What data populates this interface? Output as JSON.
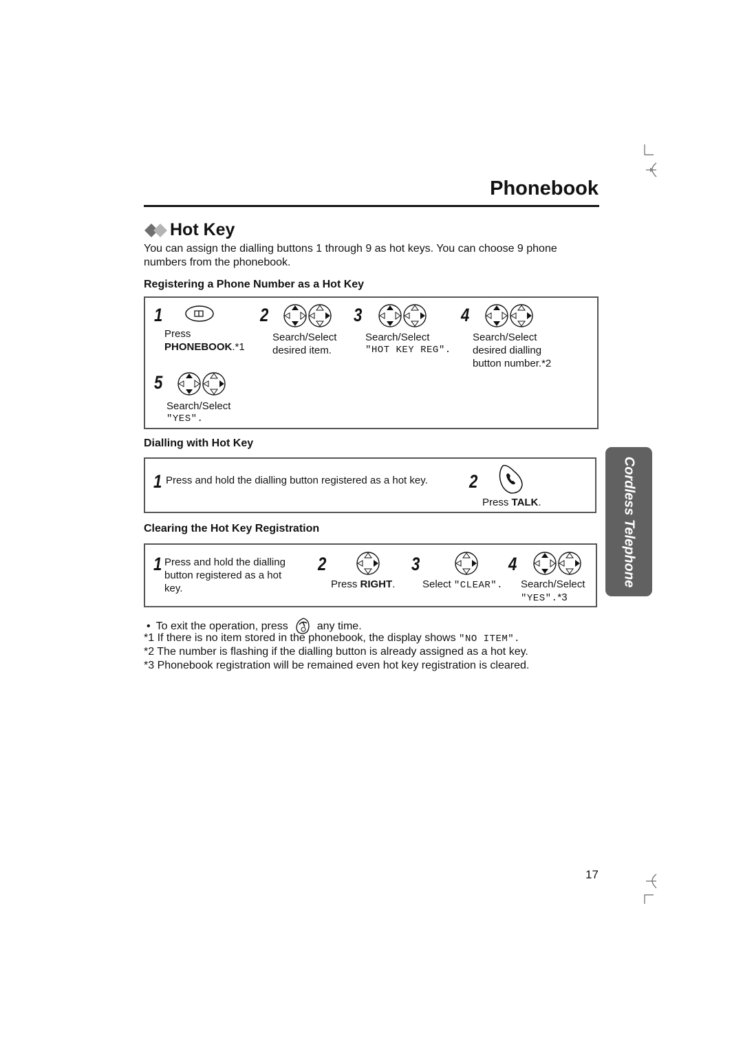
{
  "header": {
    "title": "Phonebook"
  },
  "section": {
    "title": "Hot Key",
    "intro": "You can assign the dialling buttons 1 through 9 as hot keys. You can choose 9 phone",
    "intro2": "numbers from the phonebook."
  },
  "register": {
    "heading": "Registering a Phone Number as a Hot Key",
    "steps": [
      {
        "num": "1",
        "icon": "phonebook-button-icon",
        "line1": "Press",
        "bold": "PHONEBOOK",
        "suffix": ".*1"
      },
      {
        "num": "2",
        "icon": "navigator-key-icon",
        "line1": "Search/Select",
        "line2": "desired item."
      },
      {
        "num": "3",
        "icon": "navigator-key-icon",
        "line1": "Search/Select",
        "mono": "\"HOT KEY REG\"."
      },
      {
        "num": "4",
        "icon": "navigator-key-icon",
        "line1": "Search/Select",
        "line2": "desired dialling",
        "line3": "button number.*2"
      },
      {
        "num": "5",
        "icon": "navigator-key-icon",
        "line1": "Search/Select",
        "mono": "\"YES\"."
      }
    ]
  },
  "dialling": {
    "heading": "Dialling with Hot Key",
    "steps": [
      {
        "num": "1",
        "text": "Press and hold the dialling button registered as a hot key."
      },
      {
        "num": "2",
        "icon": "talk-button-icon",
        "prefix": "Press ",
        "bold": "TALK",
        "suffix": "."
      }
    ]
  },
  "clearing": {
    "heading": "Clearing the Hot Key Registration",
    "steps": [
      {
        "num": "1",
        "line1": "Press and hold the dialling",
        "line2": "button registered as a hot",
        "line3": "key."
      },
      {
        "num": "2",
        "icon": "navigator-right-icon",
        "prefix": "Press ",
        "bold": "RIGHT",
        "suffix": "."
      },
      {
        "num": "3",
        "icon": "navigator-right-icon",
        "prefix": "Select ",
        "mono": "\"CLEAR\"."
      },
      {
        "num": "4",
        "icon": "navigator-key-icon",
        "line1": "Search/Select",
        "mono": "\"YES\".",
        "suffix": "*3"
      }
    ]
  },
  "notes": {
    "bullet": "•",
    "exit_prefix": "To exit the operation, press",
    "exit_suffix": "any time.",
    "footnotes": [
      {
        "mark": "*1",
        "text": " If there is no item stored in the phonebook, the display shows ",
        "mono": "\"NO ITEM\"."
      },
      {
        "mark": "*2",
        "text": " The number is flashing if the dialling button is already assigned as a hot key."
      },
      {
        "mark": "*3",
        "text": " Phonebook registration will be remained even hot key registration is cleared."
      }
    ]
  },
  "side_tab": {
    "label": "Cordless Telephone"
  },
  "page_number": "17"
}
